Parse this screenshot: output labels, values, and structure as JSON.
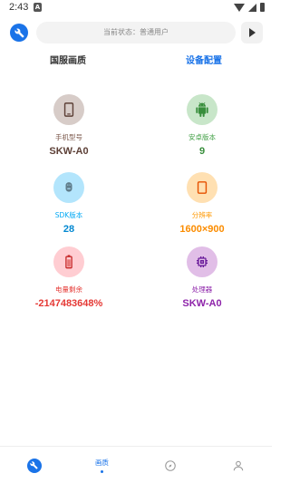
{
  "statusbar": {
    "time": "2:43",
    "alert": "A"
  },
  "header": {
    "status_text": "当前状态：普通用户"
  },
  "tabs": [
    {
      "label": "国服画质",
      "active": false
    },
    {
      "label": "设备配置",
      "active": true
    }
  ],
  "device": [
    {
      "label": "手机型号",
      "value": "SKW-A0",
      "icon": "phone-icon",
      "label_color": "#795548",
      "value_color": "#5d4037",
      "bg": "#d7ccc8"
    },
    {
      "label": "安卓版本",
      "value": "9",
      "icon": "android-icon",
      "label_color": "#43a047",
      "value_color": "#388e3c",
      "bg": "#c8e6c9"
    },
    {
      "label": "SDK版本",
      "value": "28",
      "icon": "sdk-icon",
      "label_color": "#03a9f4",
      "value_color": "#0288d1",
      "bg": "#b3e5fc"
    },
    {
      "label": "分辨率",
      "value": "1600×900",
      "icon": "screen-icon",
      "label_color": "#ff9800",
      "value_color": "#fb8c00",
      "bg": "#ffe0b2"
    },
    {
      "label": "电量剩余",
      "value": "-2147483648%",
      "icon": "battery-icon",
      "label_color": "#e53935",
      "value_color": "#e53935",
      "bg": "#ffcdd2"
    },
    {
      "label": "处理器",
      "value": "SKW-A0",
      "icon": "cpu-icon",
      "label_color": "#8e24aa",
      "value_color": "#8e24aa",
      "bg": "#e1bee7"
    }
  ],
  "bottom_nav": [
    {
      "label": "",
      "icon": "wrench-icon"
    },
    {
      "label": "画质",
      "icon": "",
      "active": true
    },
    {
      "label": "",
      "icon": "compass-icon"
    },
    {
      "label": "",
      "icon": "person-icon"
    }
  ],
  "colors": {
    "accent": "#1a73e8"
  }
}
